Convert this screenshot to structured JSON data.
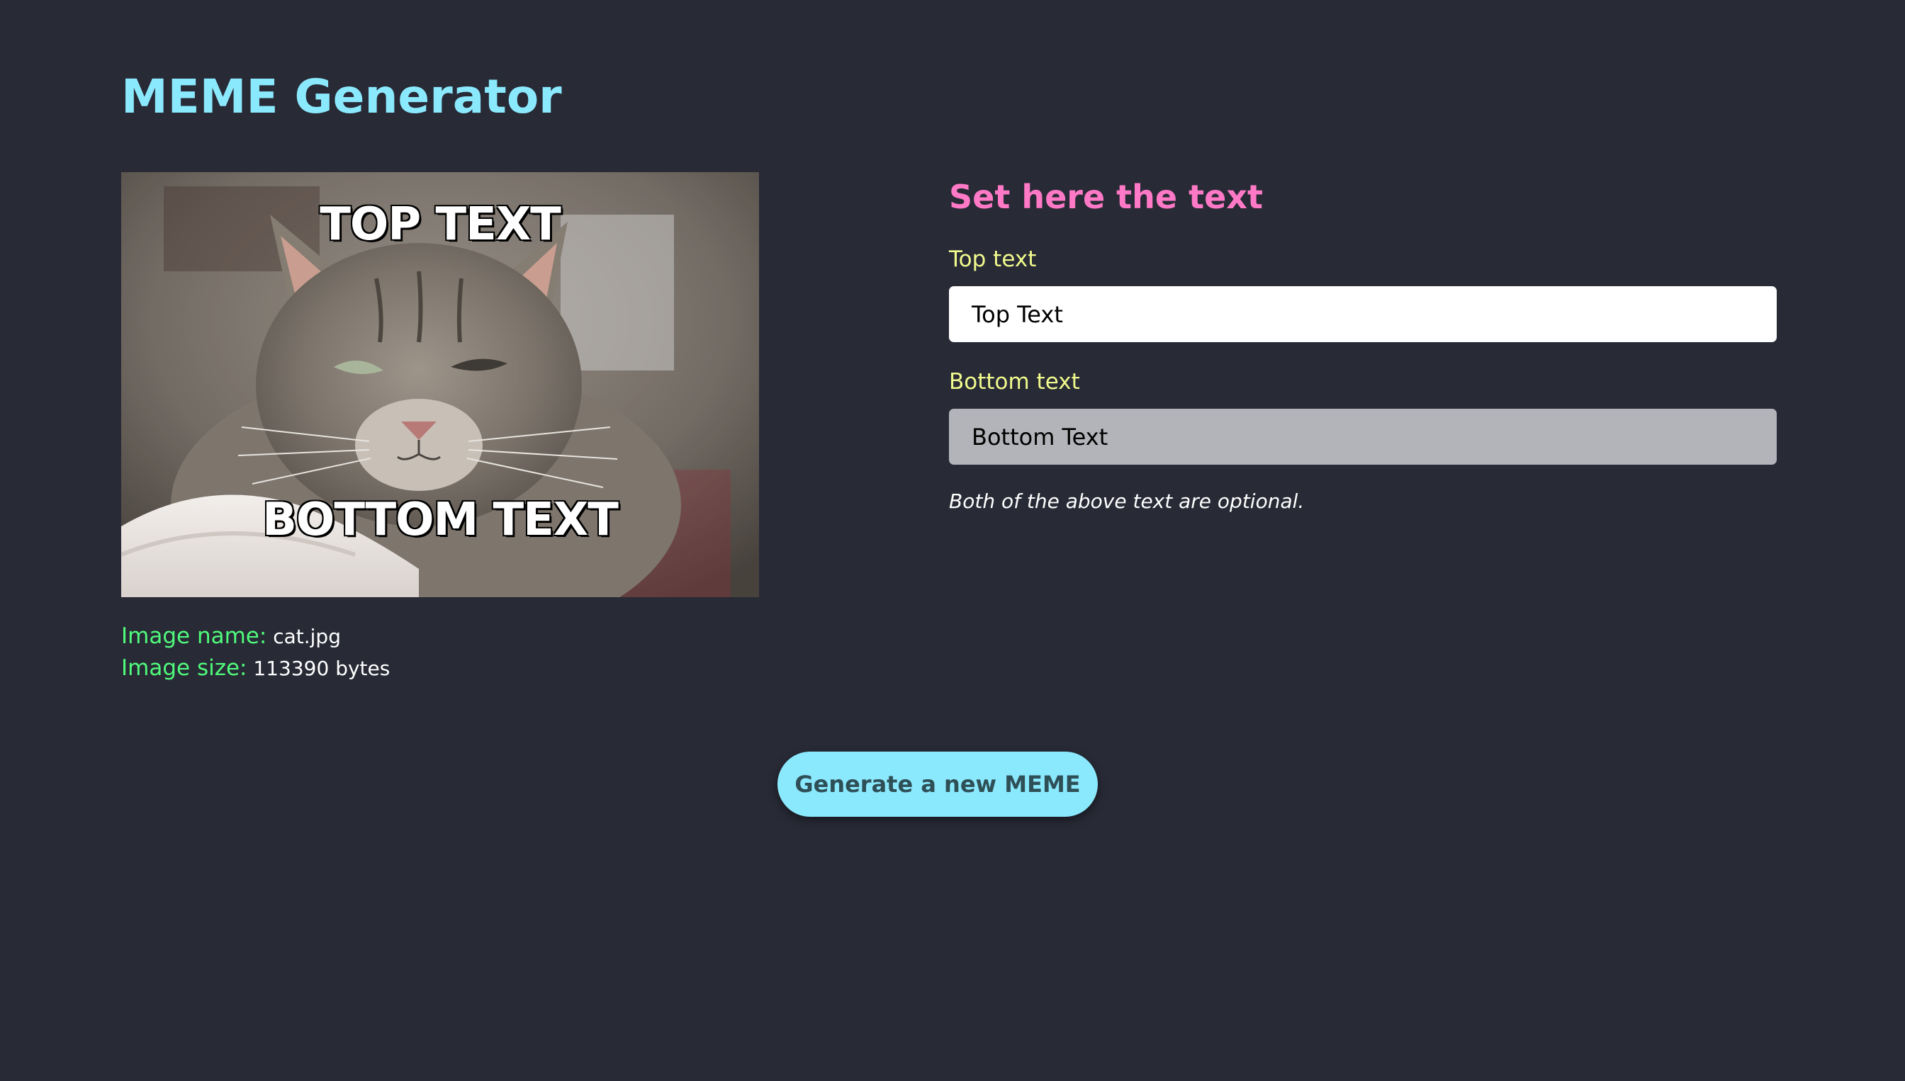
{
  "app": {
    "title": "MEME Generator"
  },
  "meme": {
    "top_text": "TOP TEXT",
    "bottom_text": "BOTTOM TEXT"
  },
  "image_info": {
    "name_label": "Image name:",
    "name_value": "cat.jpg",
    "size_label": "Image size:",
    "size_value": "113390 bytes"
  },
  "form": {
    "title": "Set here the text",
    "top_label": "Top text",
    "top_value": "Top Text",
    "bottom_label": "Bottom text",
    "bottom_value": "Bottom Text",
    "hint": "Both of the above text are optional."
  },
  "actions": {
    "generate_label": "Generate a new MEME"
  },
  "colors": {
    "background": "#282a36",
    "title": "#8be9fd",
    "form_title": "#ff79c6",
    "field_label": "#f1fa8c",
    "info_label": "#50fa7b",
    "button_bg": "#8be9fd"
  }
}
